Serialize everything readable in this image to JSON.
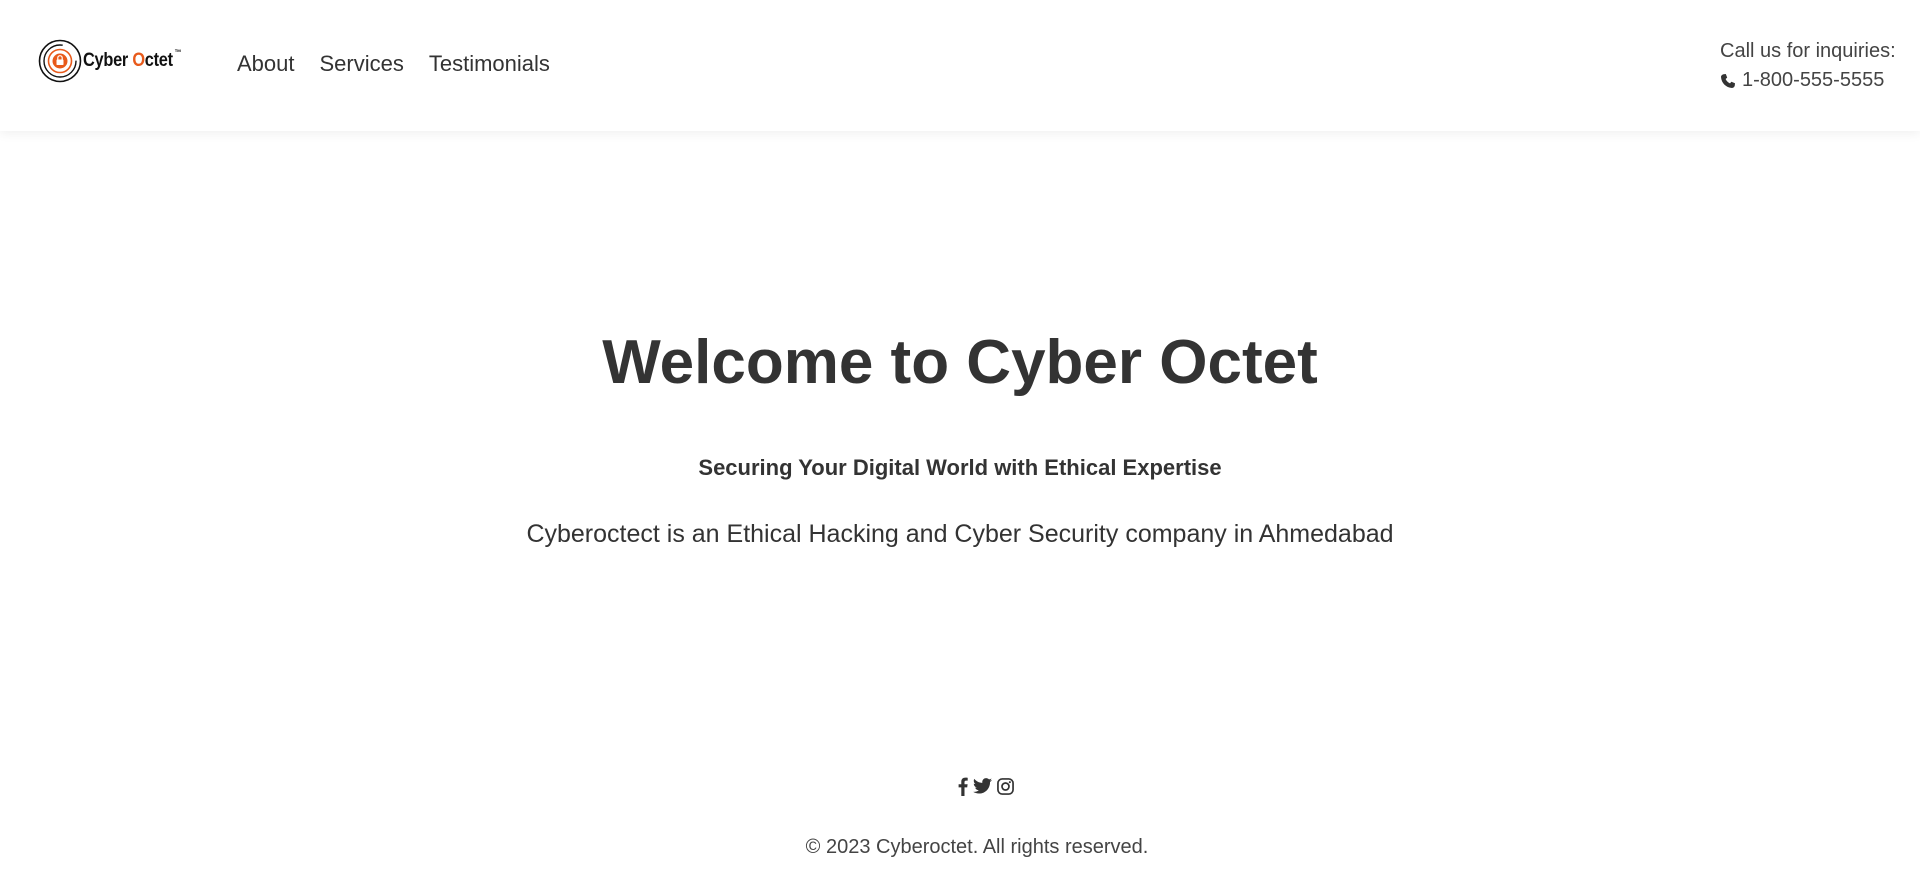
{
  "brand": {
    "logo_word_1": "Cyber",
    "logo_word_2": "O",
    "logo_word_3": "ctet",
    "trademark": "™",
    "logo_icon": "lock-target-icon",
    "accent_color": "#e85a1b"
  },
  "nav": {
    "items": [
      {
        "label": "About"
      },
      {
        "label": "Services"
      },
      {
        "label": "Testimonials"
      }
    ]
  },
  "contact": {
    "label": "Call us for inquiries:",
    "phone": "1-800-555-5555",
    "icon": "phone-icon"
  },
  "hero": {
    "title": "Welcome to Cyber Octet",
    "subtitle": "Securing Your Digital World with Ethical Expertise",
    "description": "Cyberoctect is an Ethical Hacking and Cyber Security company in Ahmedabad"
  },
  "footer": {
    "social_icons": [
      "facebook-icon",
      "twitter-icon",
      "instagram-icon"
    ],
    "copyright": "© 2023 Cyberoctet. All rights reserved."
  },
  "colors": {
    "text": "#333333",
    "background": "#ffffff"
  }
}
